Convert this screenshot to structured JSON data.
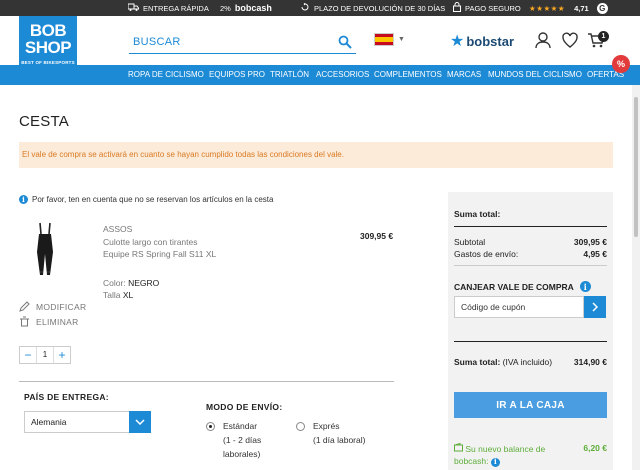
{
  "topbar": {
    "delivery": "ENTREGA RÁPIDA",
    "bobcash_pct": "2%",
    "bobcash_brand": "bobcash",
    "returns": "PLAZO DE DEVOLUCIÓN DE 30 DÍAS",
    "secure": "PAGO SEGURO",
    "stars": "★★★★★",
    "rating": "4,71",
    "rating_logo": "G"
  },
  "logo": {
    "line1": "BOB",
    "line2": "SHOP",
    "sub": "BEST OF BIKESPORTS"
  },
  "search": {
    "placeholder": "BUSCAR"
  },
  "header": {
    "bobstar_label": "bobstar",
    "cart_count": "1"
  },
  "nav": {
    "items": [
      "ROPA DE CICLISMO",
      "EQUIPOS PRO",
      "TRIATLÓN",
      "ACCESORIOS",
      "COMPLEMENTOS",
      "MARCAS",
      "MUNDOS DEL CICLISMO",
      "OFERTAS"
    ],
    "offers_badge": "%"
  },
  "page": {
    "title": "CESTA",
    "alert": "El vale de compra se activará en cuanto se hayan cumplido todas las condiciones del vale.",
    "info_note": "Por favor, ten en cuenta que no se reservan los artículos en la cesta"
  },
  "product": {
    "brand": "ASSOS",
    "name_line1": "Culotte largo con tirantes",
    "name_line2": "Equipe RS Spring Fall S11 XL",
    "price": "309,95 €",
    "color_label": "Color:",
    "color_value": "NEGRO",
    "size_label": "Talla",
    "size_value": "XL",
    "modify": "MODIFICAR",
    "delete": "ELIMINAR",
    "quantity": "1"
  },
  "delivery": {
    "country_label": "PAÍS DE ENTREGA:",
    "country_value": "Alemania",
    "shipping_label": "MODO DE ENVÍO:",
    "option1_name": "Estándar",
    "option1_detail1": "(1 - 2 días",
    "option1_detail2": "laborales)",
    "option2_name": "Exprés",
    "option2_detail": "(1 día laboral)",
    "selected": "Estándar"
  },
  "summary": {
    "title": "Suma total:",
    "subtotal_label": "Subtotal",
    "subtotal_value": "309,95 €",
    "shipping_label": "Gastos de envío:",
    "shipping_value": "4,95 €",
    "voucher_title": "CANJEAR VALE DE COMPRA",
    "coupon_placeholder": "Código de cupón",
    "total_label": "Suma total:",
    "total_note": "(IVA incluido)",
    "total_value": "314,90 €",
    "checkout": "IR A LA CAJA",
    "bobcash_line1": "Su nuevo balance de",
    "bobcash_line2": "bobcash:",
    "bobcash_value": "6,20 €"
  },
  "colors": {
    "brand_blue": "#1d8ad6",
    "topbar": "#343434",
    "alert_bg": "#fcebd8",
    "alert_text": "#d97a25",
    "bobcash_green": "#5fae3b"
  }
}
